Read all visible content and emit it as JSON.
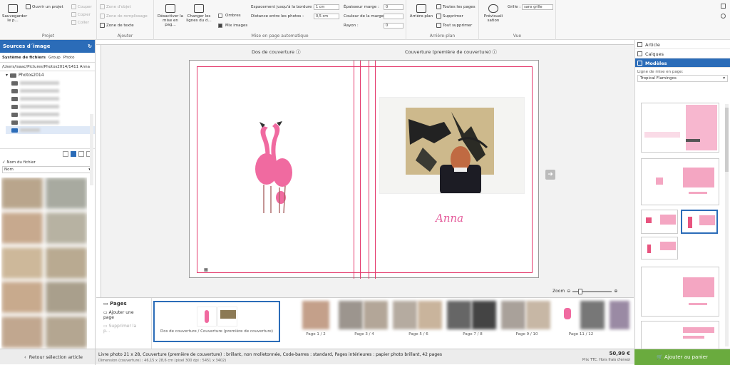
{
  "ribbon": {
    "projet": {
      "title": "Projet",
      "save_label": "Sauvegarder le p...",
      "open_label": "Ouvrir un projet",
      "cut_label": "Couper",
      "copy_label": "Copier",
      "paste_label": "Coller"
    },
    "ajouter": {
      "title": "Ajouter",
      "object_zone": "Zone d'objet",
      "fill_zone": "Zone de remplissage",
      "text_zone": "Zone de texte"
    },
    "mise_en_page": {
      "title": "Mise en page automatique",
      "disable_label": "Désactiver la mise en pag...",
      "change_lines_label": "Changer les lignes du d...",
      "shadows_label": "Ombres",
      "mix_images_label": "Mix images",
      "spacing_border_label": "Espacement jusqu'à la bordure :",
      "spacing_border_value": "1 cm",
      "spacing_photos_label": "Distance entre les photos :",
      "spacing_photos_value": "0,5 cm",
      "margin_thickness_label": "Épaisseur marge :",
      "margin_thickness_value": "0",
      "margin_color_label": "Couleur de la marge :",
      "radius_label": "Rayon :",
      "radius_value": "0"
    },
    "arriere_plan": {
      "title": "Arrière-plan",
      "background_label": "Arrière-plan",
      "all_pages_label": "Toutes les pages",
      "delete_label": "Supprimer",
      "delete_all_label": "Tout supprimer"
    },
    "vue": {
      "title": "Vue",
      "preview_label": "Prévisuali sation",
      "grid_label": "Grille :",
      "grid_value": "sans grille"
    }
  },
  "left_panel": {
    "title": "Sources d´image",
    "tab_filesystem": "Système de fichiers",
    "tab_group": "Group",
    "tab_photo": "Photo",
    "path": "/Users/isaac/Pictures/Photos2014/1411 Anna",
    "tree_folder": "Photos2014",
    "filename_label": "Nom du fichier",
    "sort_value": "Nom"
  },
  "canvas": {
    "back_cover_label": "Dos de couverture",
    "front_cover_label": "Couverture (première de couverture)",
    "title_text": "Anna",
    "zoom_label": "Zoom"
  },
  "pages_bar": {
    "title": "Pages",
    "add_page": "Ajouter une page",
    "delete_page": "Supprimer la p...",
    "thumbs": [
      {
        "label": "Dos de couverture / Couverture (première de couverture)"
      },
      {
        "label": "Page 1 / 2"
      },
      {
        "label": "Page 3 / 4"
      },
      {
        "label": "Page 5 / 6"
      },
      {
        "label": "Page 7 / 8"
      },
      {
        "label": "Page 9 / 10"
      },
      {
        "label": "Page 11 / 12"
      }
    ]
  },
  "right_panel": {
    "tab_article": "Article",
    "tab_layers": "Calques",
    "tab_models": "Modèles",
    "layout_line_label": "Ligne de mise en page:",
    "layout_line_value": "Tropical Flamingos"
  },
  "status_bar": {
    "back_button": "Retour sélection article",
    "info_line": "Livre photo 21 x 28, Couverture (première de couverture) : brillant, non molletonnée, Code-barres : standard, Pages intérieures : papier photo brillant, 42 pages",
    "dimension_line": "Dimension (couverture) : 46,15 x 28,6 cm (pixel 300 dpi : 5451 x 3402)",
    "price": "50,99 €",
    "price_note": "Prix TTC. Hors frais d'envoi",
    "cart_button": "Ajouter au panier"
  },
  "colors": {
    "accent": "#2b6cb8",
    "cut_line": "#e43a6d",
    "cart": "#6aab3e",
    "flamingo": "#f06aa0"
  }
}
